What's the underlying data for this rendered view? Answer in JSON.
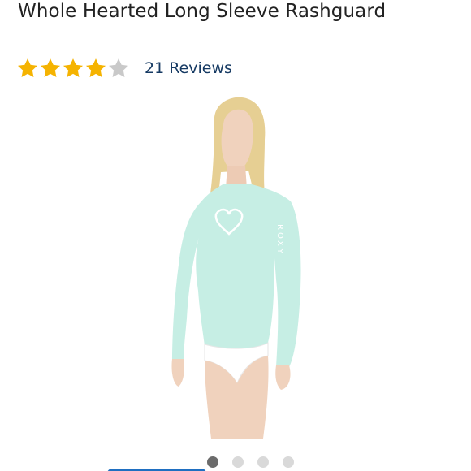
{
  "product": {
    "title": "Whole Hearted Long Sleeve Rashguard",
    "rating": 4,
    "rating_max": 5,
    "reviews_label": "21 Reviews"
  },
  "colors": {
    "star_filled": "#f5b301",
    "star_empty": "#c9c9c9",
    "link": "#163a63",
    "dot_active": "#6b6b6b",
    "dot_inactive": "#d9d9d9",
    "rashguard": "#c6eee4",
    "button": "#1f6fc1"
  },
  "carousel": {
    "count": 4,
    "active_index": 0
  },
  "icons": [
    "star-icon",
    "product-photo"
  ]
}
